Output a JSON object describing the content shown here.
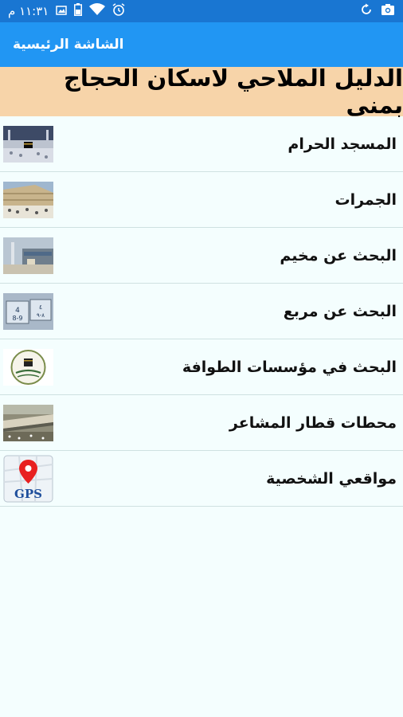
{
  "status_bar": {
    "time": "١١:٣١ م",
    "icons": [
      "camera-icon",
      "sync-icon",
      "alarm-icon",
      "wifi-icon",
      "battery-icon",
      "image-icon"
    ]
  },
  "app_bar": {
    "title": "الشاشة الرئيسية"
  },
  "banner": {
    "title": "الدليل الملاحي لاسكان الحجاج بمنى"
  },
  "menu": {
    "items": [
      {
        "label": "المسجد الحرام",
        "thumbnail": "masjid-haram-thumbnail"
      },
      {
        "label": "الجمرات",
        "thumbnail": "jamarat-thumbnail"
      },
      {
        "label": "البحث عن مخيم",
        "thumbnail": "camp-search-thumbnail"
      },
      {
        "label": "البحث عن مربع",
        "thumbnail": "square-search-thumbnail"
      },
      {
        "label": "البحث في مؤسسات الطوافة",
        "thumbnail": "tawafa-institutions-thumbnail"
      },
      {
        "label": "محطات قطار المشاعر",
        "thumbnail": "mashaer-train-thumbnail"
      },
      {
        "label": "مواقعي الشخصية",
        "thumbnail": "gps-thumbnail",
        "thumbnail_text": "GPS"
      }
    ]
  },
  "colors": {
    "status_bar": "#1976d2",
    "app_bar": "#2196f3",
    "banner": "#f7d4a9",
    "background": "#f4fefe",
    "divider": "#cfe1e1"
  }
}
